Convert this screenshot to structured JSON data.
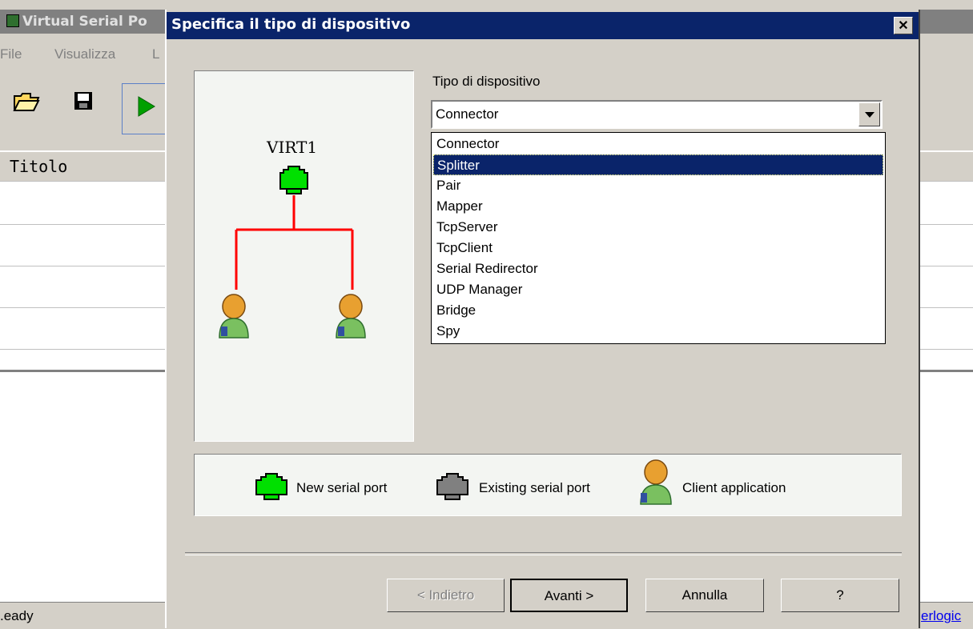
{
  "background_window": {
    "title": "Virtual Serial Po",
    "menu": [
      "File",
      "Visualizza",
      "L"
    ],
    "column_header": "Titolo",
    "status": "Ready",
    "status_display": ".eady",
    "link": "erlogic"
  },
  "dialog": {
    "title": "Specifica il tipo di dispositivo",
    "close_label": "✕",
    "illustration": {
      "port_label": "VIRT1",
      "line_color": "#ff0000",
      "port_color": "#00e000"
    },
    "device_type_label": "Tipo di dispositivo",
    "combo_value": "Connector",
    "dropdown_options": [
      "Connector",
      "Splitter",
      "Pair",
      "Mapper",
      "TcpServer",
      "TcpClient",
      "Serial Redirector",
      "UDP Manager",
      "Bridge",
      "Spy"
    ],
    "selected_option": "Splitter",
    "legend": {
      "new_port": "New serial port",
      "existing_port": "Existing serial port",
      "client_app": "Client application"
    },
    "buttons": {
      "back": "< Indietro",
      "next": "Avanti >",
      "cancel": "Annulla",
      "help": "?"
    }
  },
  "colors": {
    "title_active": "#0a246a",
    "selection": "#0a246a",
    "face": "#d4d0c8"
  }
}
